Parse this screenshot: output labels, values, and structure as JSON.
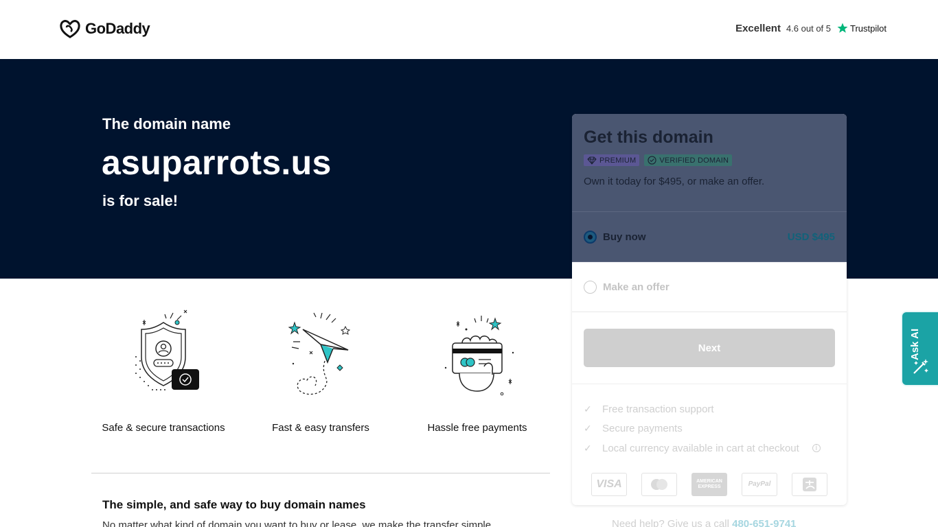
{
  "header": {
    "logo_text": "GoDaddy",
    "trust_rating": "Excellent",
    "trust_score": "4.6 out of 5",
    "trust_brand": "Trustpilot"
  },
  "hero": {
    "subtitle": "The domain name",
    "domain": "asuparrots.us",
    "tagline": "is for sale!"
  },
  "card": {
    "title": "Get this domain",
    "badge_premium": "PREMIUM",
    "badge_verified": "VERIFIED DOMAIN",
    "description": "Own it today for $495, or make an offer.",
    "option_buy_label": "Buy now",
    "option_buy_price": "USD $495",
    "option_buy_selected": true,
    "option_offer_label": "Make an offer",
    "next_label": "Next",
    "features": [
      "Free transaction support",
      "Secure payments",
      "Local currency available in cart at checkout"
    ],
    "payment_methods": [
      "VISA",
      "Mastercard",
      "AMERICAN EXPRESS",
      "PayPal",
      "Alipay"
    ]
  },
  "help": {
    "text": "Need help? Give us a call",
    "phone": "480-651-9741"
  },
  "features": [
    {
      "label": "Safe & secure transactions",
      "icon": "shield-icon"
    },
    {
      "label": "Fast & easy transfers",
      "icon": "paper-plane-icon"
    },
    {
      "label": "Hassle free payments",
      "icon": "card-payment-icon"
    }
  ],
  "info": {
    "title": "The simple, and safe way to buy domain names",
    "text": "No matter what kind of domain you want to buy or lease, we make the transfer simple"
  },
  "ask_ai": {
    "label": "Ask AI"
  },
  "colors": {
    "hero_bg": "#00132e",
    "accent": "#1ba3a5",
    "trustpilot_green": "#00b67a"
  }
}
